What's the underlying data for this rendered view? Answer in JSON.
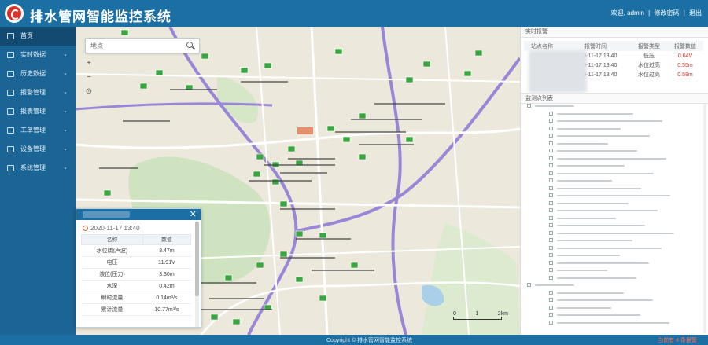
{
  "header": {
    "title": "排水管网智能监控系统",
    "user_label": "欢迎, admin",
    "change_password": "修改密码",
    "logout": "退出"
  },
  "sidebar": {
    "items": [
      {
        "label": "首页",
        "icon": "home-icon",
        "active": true
      },
      {
        "label": "实时数据",
        "icon": "monitor-icon"
      },
      {
        "label": "历史数据",
        "icon": "history-icon"
      },
      {
        "label": "报警管理",
        "icon": "alarm-icon"
      },
      {
        "label": "报表管理",
        "icon": "report-icon"
      },
      {
        "label": "工单管理",
        "icon": "workorder-icon"
      },
      {
        "label": "设备管理",
        "icon": "device-icon"
      },
      {
        "label": "系统管理",
        "icon": "settings-icon"
      }
    ]
  },
  "map": {
    "search_placeholder": "地点",
    "zoom_in": "+",
    "zoom_out": "−",
    "locate": "⊙",
    "scale_labels": [
      "0",
      "1",
      "2km"
    ]
  },
  "popup": {
    "time": "2020-11-17 13:40",
    "columns": [
      "名称",
      "数值"
    ],
    "rows": [
      [
        "水位(超声波)",
        "3.47m"
      ],
      [
        "电压",
        "11.91V"
      ],
      [
        "液位(压力)",
        "3.30m"
      ],
      [
        "水深",
        "0.42m"
      ],
      [
        "瞬时流量",
        "0.14m³/s"
      ],
      [
        "累计流量",
        "10.77m³/s"
      ]
    ]
  },
  "right_panel": {
    "alarm_title": "实时报警",
    "alarm_columns": [
      "站点名称",
      "报警时间",
      "报警类型",
      "报警数值"
    ],
    "alarm_rows": [
      {
        "time": "2020-11-17 13:40",
        "type": "低压",
        "value": "0.64V"
      },
      {
        "time": "2020-11-17 13:40",
        "type": "水位过高",
        "value": "0.55m"
      },
      {
        "time": "2020-11-17 13:40",
        "type": "水位过高",
        "value": "0.58m"
      }
    ],
    "tree_title": "监测点列表"
  },
  "footer": {
    "copyright": "Copyright © 排水管网智能监控系统",
    "alarm_text": "当前有 4 条报警"
  },
  "colors": {
    "header": "#1b6fa3",
    "sidebar": "#1a6496",
    "alarm_red": "#d4362a",
    "road_major": "#9a86d6",
    "station_marker": "#3aa541"
  }
}
